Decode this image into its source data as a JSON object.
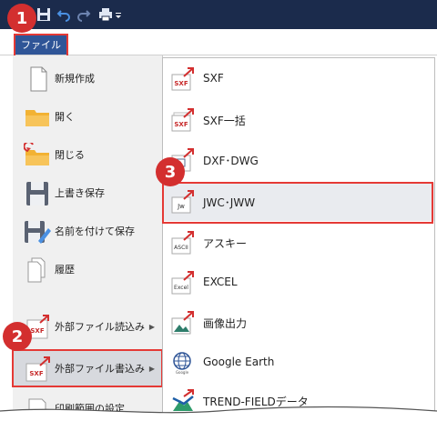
{
  "ribbon": {
    "file_tab_label": "ファイル"
  },
  "backstage": {
    "items": [
      {
        "label": "新規作成",
        "icon": "new-document-icon"
      },
      {
        "label": "開く",
        "icon": "folder-open-icon"
      },
      {
        "label": "閉じる",
        "icon": "folder-close-icon"
      },
      {
        "label": "上書き保存",
        "icon": "floppy-disk-icon"
      },
      {
        "label": "名前を付けて保存",
        "icon": "save-as-icon"
      },
      {
        "label": "履歴",
        "icon": "history-icon"
      },
      {
        "label": "外部ファイル読込み",
        "icon": "sxf-import-icon",
        "arrow": "▶"
      },
      {
        "label": "外部ファイル書込み",
        "icon": "sxf-export-icon",
        "arrow": "▶"
      },
      {
        "label": "印刷範囲の設定",
        "icon": "print-range-icon"
      }
    ]
  },
  "submenu": {
    "items": [
      {
        "label": "SXF",
        "icon_text": "SXF"
      },
      {
        "label": "SXF一括",
        "icon_text": "SXF"
      },
      {
        "label": "DXF･DWG",
        "icon_text": ""
      },
      {
        "label": "JWC･JWW",
        "icon_text": "Jw"
      },
      {
        "label": "アスキー",
        "icon_text": "ASCII"
      },
      {
        "label": "EXCEL",
        "icon_text": "Excel"
      },
      {
        "label": "画像出力",
        "icon_text": ""
      },
      {
        "label": "Google Earth",
        "icon_text": "Google"
      },
      {
        "label": "TREND-FIELDデータ",
        "icon_text": ""
      }
    ]
  },
  "callouts": {
    "one": "1",
    "two": "2",
    "three": "3"
  },
  "colors": {
    "accent_red": "#e53935",
    "badge_red": "#d32f2f",
    "title_bar": "#1b2b4c",
    "file_tab": "#2f5597"
  }
}
